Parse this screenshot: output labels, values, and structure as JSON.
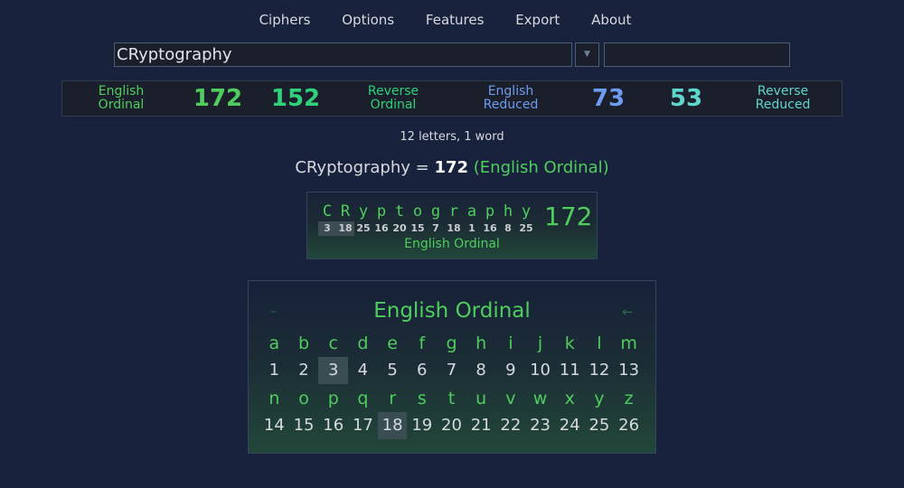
{
  "nav": {
    "items": [
      "Ciphers",
      "Options",
      "Features",
      "Export",
      "About"
    ]
  },
  "input": {
    "phrase_value": "CRyptography",
    "dropdown_icon": "▼",
    "second_value": ""
  },
  "summary": {
    "cells": [
      {
        "label_line1": "English",
        "label_line2": "Ordinal",
        "color": "#4fce5d"
      },
      {
        "value": "172",
        "color": "#4fce5d"
      },
      {
        "value": "152",
        "color": "#2fd17a"
      },
      {
        "label_line1": "Reverse",
        "label_line2": "Ordinal",
        "color": "#2fd17a"
      },
      {
        "label_line1": "English",
        "label_line2": "Reduced",
        "color": "#6e9cf0"
      },
      {
        "value": "73",
        "color": "#6e9cf0"
      },
      {
        "value": "53",
        "color": "#5fd6cc"
      },
      {
        "label_line1": "Reverse",
        "label_line2": "Reduced",
        "color": "#5fd6cc"
      }
    ]
  },
  "stats": {
    "letter_count": "12 letters, 1 word"
  },
  "result": {
    "phrase": "CRyptography",
    "equals": " = ",
    "value": "172",
    "cipher": "(English Ordinal)"
  },
  "breakdown": {
    "letters": [
      {
        "ch": "C",
        "num": "3",
        "highlight": true
      },
      {
        "ch": "R",
        "num": "18",
        "highlight": true
      },
      {
        "ch": "y",
        "num": "25"
      },
      {
        "ch": "p",
        "num": "16"
      },
      {
        "ch": "t",
        "num": "20"
      },
      {
        "ch": "o",
        "num": "15"
      },
      {
        "ch": "g",
        "num": "7"
      },
      {
        "ch": "r",
        "num": "18"
      },
      {
        "ch": "a",
        "num": "1"
      },
      {
        "ch": "p",
        "num": "16"
      },
      {
        "ch": "h",
        "num": "8"
      },
      {
        "ch": "y",
        "num": "25"
      }
    ],
    "total": "172",
    "cipher_name": "English Ordinal"
  },
  "cipher_table": {
    "title": "English Ordinal",
    "minus_icon": "–",
    "back_icon": "←",
    "rows": [
      {
        "letters": [
          "a",
          "b",
          "c",
          "d",
          "e",
          "f",
          "g",
          "h",
          "i",
          "j",
          "k",
          "l",
          "m"
        ],
        "numbers": [
          "1",
          "2",
          "3",
          "4",
          "5",
          "6",
          "7",
          "8",
          "9",
          "10",
          "11",
          "12",
          "13"
        ],
        "highlighted": [
          "3"
        ]
      },
      {
        "letters": [
          "n",
          "o",
          "p",
          "q",
          "r",
          "s",
          "t",
          "u",
          "v",
          "w",
          "x",
          "y",
          "z"
        ],
        "numbers": [
          "14",
          "15",
          "16",
          "17",
          "18",
          "19",
          "20",
          "21",
          "22",
          "23",
          "24",
          "25",
          "26"
        ],
        "highlighted": [
          "18"
        ]
      }
    ]
  },
  "colors": {
    "background": "#18223c",
    "accent_green": "#4fce5d",
    "input_bg": "#1b1f2b"
  }
}
